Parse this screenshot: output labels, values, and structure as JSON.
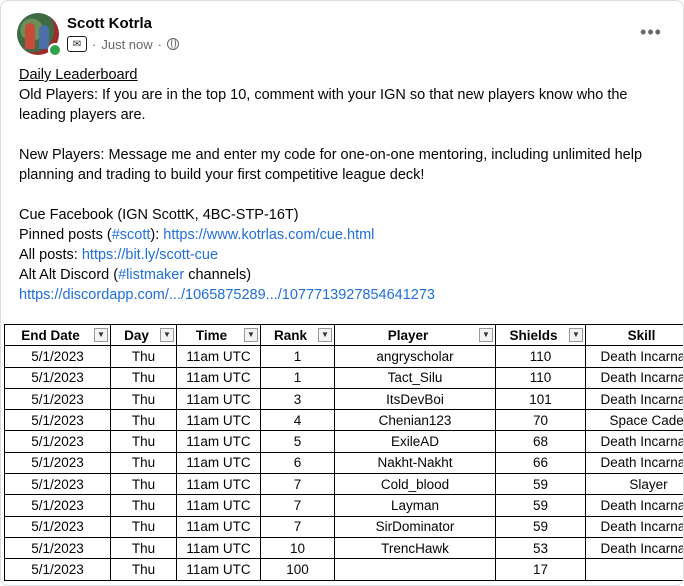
{
  "post": {
    "author": "Scott Kotrla",
    "time": "Just now",
    "separator": "·",
    "more_label": "•••",
    "group_icon": "group-chat-icon",
    "privacy_icon": "globe-icon"
  },
  "content": {
    "heading": "Daily Leaderboard",
    "old_players": "Old Players: If you are in the top 10, comment with your IGN so that new players know who the leading players are.",
    "new_players": "New Players: Message me and enter my code for one-on-one mentoring, including unlimited help planning and trading to build your first competitive league deck!",
    "cue_facebook": "Cue Facebook (IGN ScottK, 4BC-STP-16T)",
    "pinned_prefix": "Pinned posts (",
    "pinned_tag": "#scott",
    "pinned_mid": "): ",
    "pinned_link": "https://www.kotrlas.com/cue.html",
    "all_prefix": "All posts: ",
    "all_link": "https://bit.ly/scott-cue",
    "alt_prefix": "Alt Alt Discord (",
    "alt_tag": "#listmaker",
    "alt_suffix": " channels)",
    "discord_link": "https://discordapp.com/.../1065875289.../1077713927854641273"
  },
  "table": {
    "headers": [
      "End Date",
      "Day",
      "Time",
      "Rank",
      "Player",
      "Shields",
      "Skill"
    ],
    "rows": [
      [
        "5/1/2023",
        "Thu",
        "11am UTC",
        "1",
        "angryscholar",
        "110",
        "Death Incarnate"
      ],
      [
        "5/1/2023",
        "Thu",
        "11am UTC",
        "1",
        "Tact_Silu",
        "110",
        "Death Incarnate"
      ],
      [
        "5/1/2023",
        "Thu",
        "11am UTC",
        "3",
        "ItsDevBoi",
        "101",
        "Death Incarnate"
      ],
      [
        "5/1/2023",
        "Thu",
        "11am UTC",
        "4",
        "Chenian123",
        "70",
        "Space Cadet"
      ],
      [
        "5/1/2023",
        "Thu",
        "11am UTC",
        "5",
        "ExileAD",
        "68",
        "Death Incarnate"
      ],
      [
        "5/1/2023",
        "Thu",
        "11am UTC",
        "6",
        "Nakht-Nakht",
        "66",
        "Death Incarnate"
      ],
      [
        "5/1/2023",
        "Thu",
        "11am UTC",
        "7",
        "Cold_blood",
        "59",
        "Slayer"
      ],
      [
        "5/1/2023",
        "Thu",
        "11am UTC",
        "7",
        "Layman",
        "59",
        "Death Incarnate"
      ],
      [
        "5/1/2023",
        "Thu",
        "11am UTC",
        "7",
        "SirDominator",
        "59",
        "Death Incarnate"
      ],
      [
        "5/1/2023",
        "Thu",
        "11am UTC",
        "10",
        "TrencHawk",
        "53",
        "Death Incarnate"
      ],
      [
        "5/1/2023",
        "Thu",
        "11am UTC",
        "100",
        "",
        "17",
        ""
      ]
    ],
    "filter_icons": [
      "filter-active-icon",
      "filter-active-icon",
      "dropdown-arrow-icon",
      "dropdown-arrow-icon",
      "dropdown-arrow-icon",
      "dropdown-arrow-icon",
      "dropdown-arrow-icon"
    ]
  }
}
